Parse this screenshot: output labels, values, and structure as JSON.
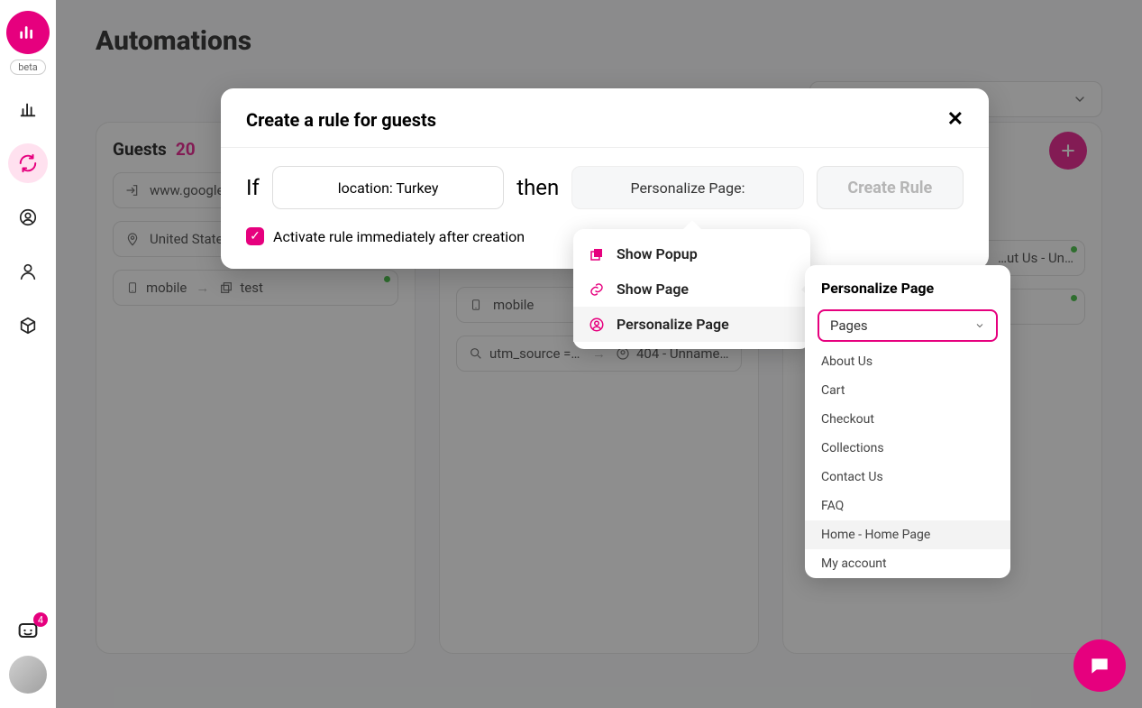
{
  "sidebar": {
    "beta": "beta",
    "bot_badge": "4"
  },
  "page": {
    "title": "Automations"
  },
  "columns": [
    {
      "title": "Guests",
      "count": "20",
      "cards": [
        {
          "left_icon": "enter",
          "left": "www.google...",
          "right_icon": "",
          "right": ""
        },
        {
          "left_icon": "pin",
          "left": "United States",
          "right_icon": "",
          "right": ""
        },
        {
          "left_icon": "mobile",
          "left": "mobile",
          "right_icon": "layers",
          "right": "test"
        }
      ]
    },
    {
      "title": "",
      "count": "",
      "cards": [
        {
          "left_icon": "mobile",
          "left": "mobile",
          "right_icon": "",
          "right": ""
        },
        {
          "left_icon": "search",
          "left": "utm_source = …",
          "right_icon": "person-circle",
          "right": "404 - Unname…"
        }
      ]
    },
    {
      "title": "",
      "count": "",
      "cards": [
        {
          "left_icon": "",
          "left": "",
          "right_icon": "",
          "right": "…ut Us - Un…"
        },
        {
          "left_icon": "",
          "left": "",
          "right_icon": "",
          "right": ""
        }
      ]
    }
  ],
  "modal": {
    "title": "Create a rule for guests",
    "if": "If",
    "condition": "location: Turkey",
    "then": "then",
    "action_label": "Personalize Page:",
    "create": "Create Rule",
    "activate": "Activate rule immediately after creation"
  },
  "action_menu": [
    {
      "icon": "popup",
      "label": "Show Popup"
    },
    {
      "icon": "link",
      "label": "Show Page"
    },
    {
      "icon": "person-circle",
      "label": "Personalize Page"
    }
  ],
  "pages_panel": {
    "title": "Personalize Page",
    "select_label": "Pages",
    "options": [
      "About Us",
      "Cart",
      "Checkout",
      "Collections",
      "Contact Us",
      "FAQ",
      "Home - Home Page",
      "My account"
    ],
    "highlight_index": 6
  }
}
